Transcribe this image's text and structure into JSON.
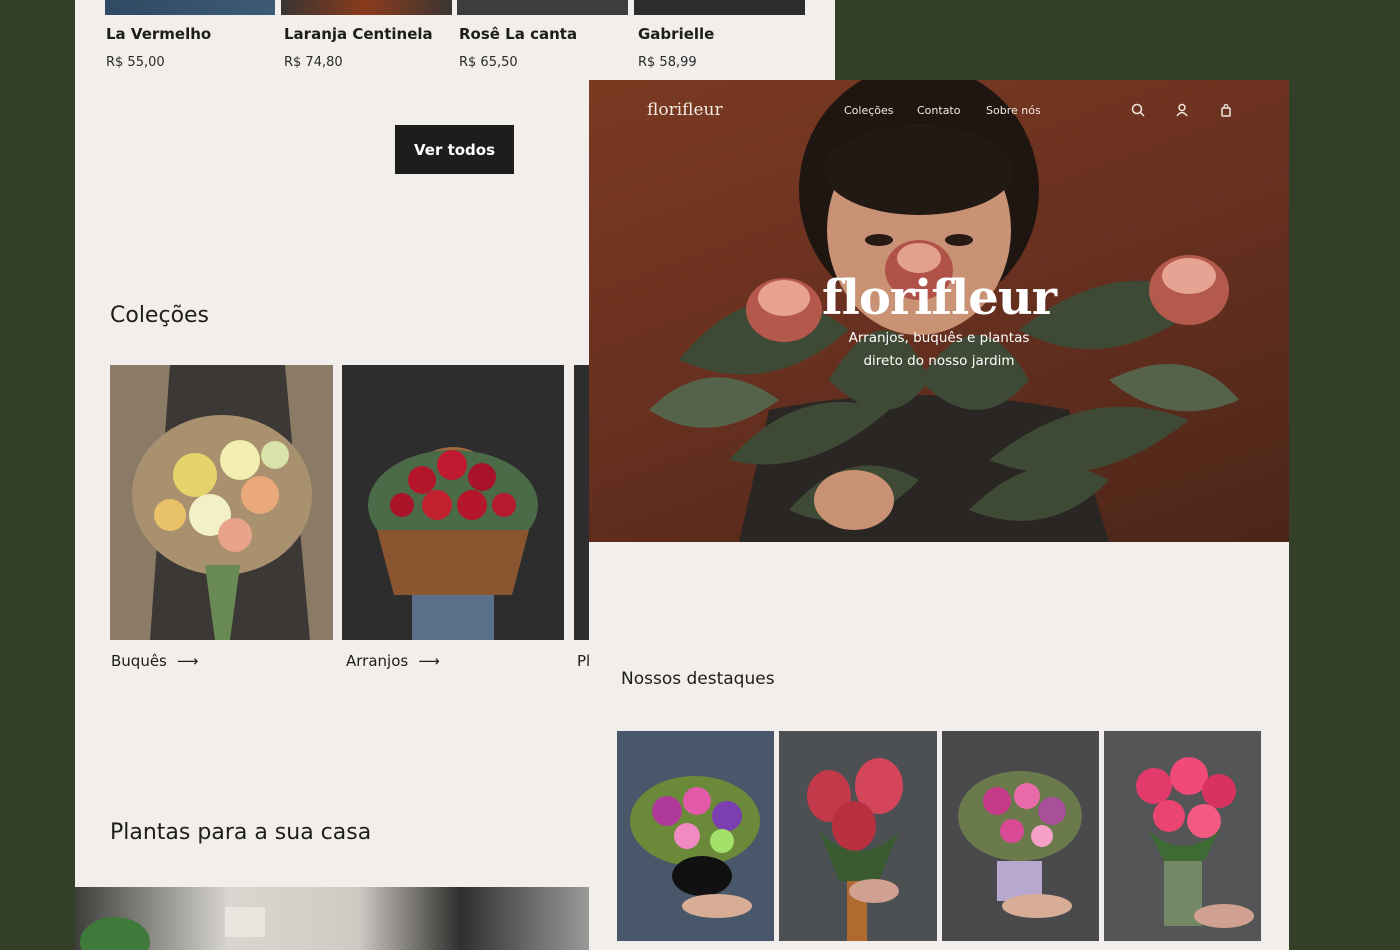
{
  "back_page": {
    "products": [
      {
        "name": "La Vermelho",
        "price": "R$ 55,00"
      },
      {
        "name": "Laranja Centinela",
        "price": "R$ 74,80"
      },
      {
        "name": "Rosê La canta",
        "price": "R$ 65,50"
      },
      {
        "name": "Gabrielle",
        "price": "R$ 58,99"
      }
    ],
    "ver_todos_label": "Ver todos",
    "colecoes_title": "Coleções",
    "collections": [
      {
        "label": "Buquês"
      },
      {
        "label": "Arranjos"
      },
      {
        "label": "Pl"
      }
    ],
    "plantas_title": "Plantas para a sua casa"
  },
  "front_page": {
    "nav": {
      "logo": "florifleur",
      "links": [
        "Coleções",
        "Contato",
        "Sobre nós"
      ],
      "icons": [
        "search-icon",
        "user-icon",
        "bag-icon"
      ]
    },
    "hero": {
      "title": "florifleur",
      "subtitle_line1": "Arranjos, buquês e plantas",
      "subtitle_line2": "direto do nosso jardim"
    },
    "destaques_title": "Nossos destaques"
  },
  "colors": {
    "background": "#343f27",
    "page": "#f1eeeb",
    "button": "#1d1d1b",
    "hero": "#6a3120"
  }
}
